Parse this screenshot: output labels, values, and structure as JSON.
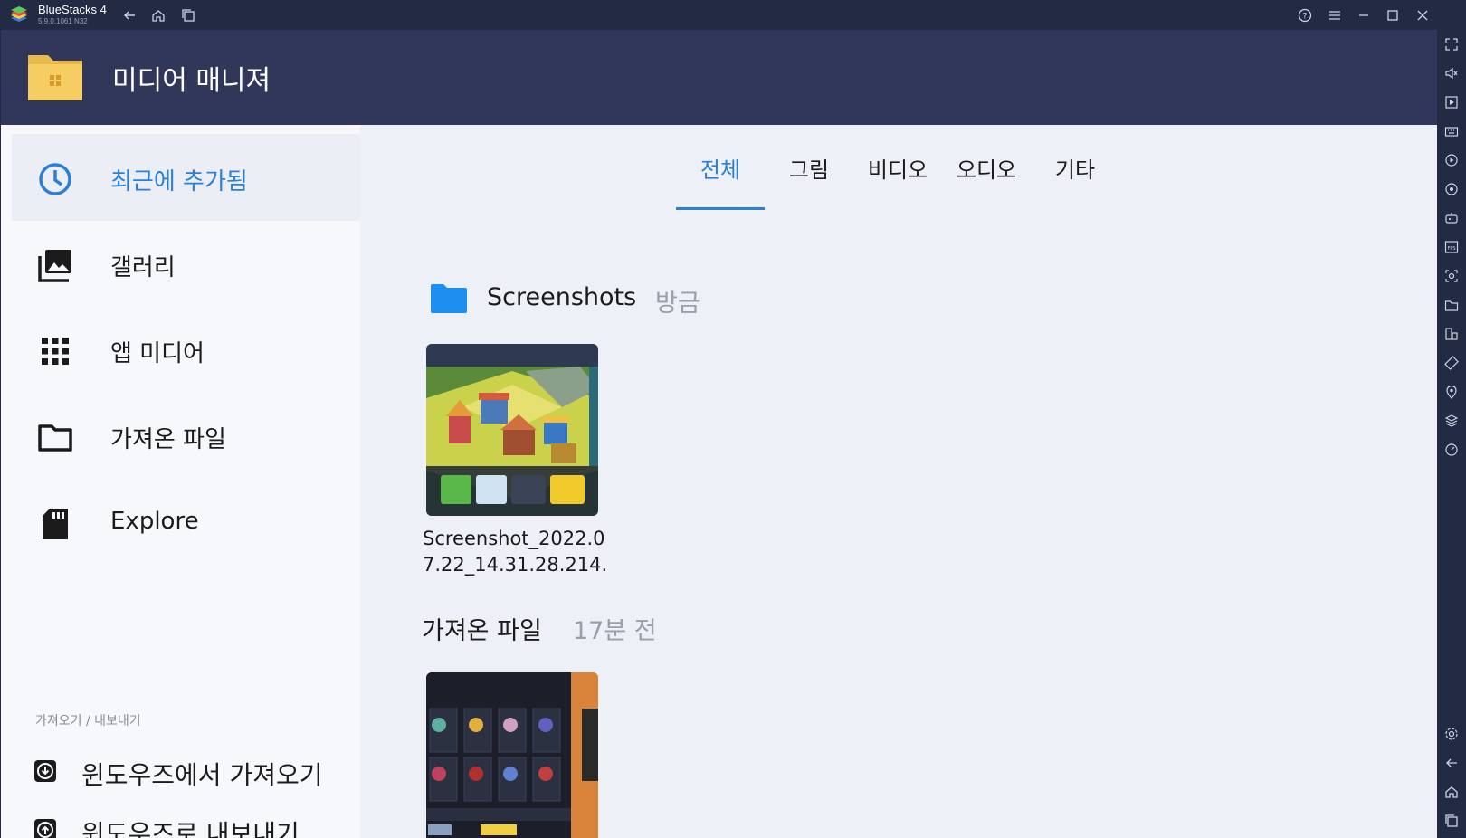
{
  "window": {
    "app_name": "BlueStacks 4",
    "version": "5.9.0.1061 N32"
  },
  "app": {
    "title": "미디어 매니져"
  },
  "sidebar": {
    "items": [
      {
        "label": "최근에 추가됨",
        "icon": "clock-icon",
        "active": true
      },
      {
        "label": "갤러리",
        "icon": "gallery-icon",
        "active": false
      },
      {
        "label": "앱 미디어",
        "icon": "grid-icon",
        "active": false
      },
      {
        "label": "가져온 파일",
        "icon": "folder-icon",
        "active": false
      },
      {
        "label": "Explore",
        "icon": "sd-card-icon",
        "active": false
      }
    ],
    "section_label": "가져오기 / 내보내기",
    "io_items": [
      {
        "label": "윈도우즈에서 가져오기",
        "icon": "import-icon"
      },
      {
        "label": "윈도우즈로 내보내기",
        "icon": "export-icon"
      }
    ]
  },
  "tabs": [
    {
      "label": "전체",
      "active": true
    },
    {
      "label": "그림",
      "active": false
    },
    {
      "label": "비디오",
      "active": false
    },
    {
      "label": "오디오",
      "active": false
    },
    {
      "label": "기타",
      "active": false
    }
  ],
  "groups": [
    {
      "name": "Screenshots",
      "time": "방금",
      "files": [
        {
          "name": "Screenshot_2022.07.22_14.31.28.214."
        }
      ]
    },
    {
      "name": "가져온 파일",
      "time": "17분 전",
      "files": [
        {
          "name": ""
        }
      ]
    }
  ],
  "colors": {
    "accent": "#2a7fd8",
    "header": "#30375a",
    "titlebar": "#222a44",
    "background": "#eef0f7"
  }
}
